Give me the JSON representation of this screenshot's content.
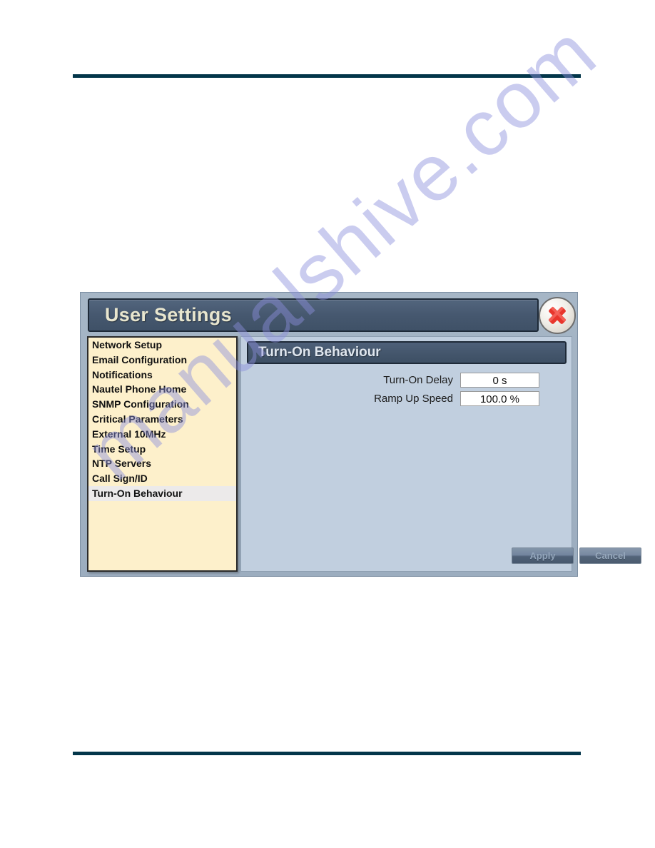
{
  "page": {
    "rule_color": "#03364a",
    "watermark": "manualshive.com"
  },
  "dialog": {
    "title": "User Settings",
    "close_icon": "close-x-icon",
    "sidebar": {
      "items": [
        {
          "label": "Network Setup",
          "selected": false
        },
        {
          "label": "Email Configuration",
          "selected": false
        },
        {
          "label": "Notifications",
          "selected": false
        },
        {
          "label": "Nautel Phone Home",
          "selected": false
        },
        {
          "label": "SNMP Configuration",
          "selected": false
        },
        {
          "label": "Critical Parameters",
          "selected": false
        },
        {
          "label": "External 10MHz",
          "selected": false
        },
        {
          "label": "Time Setup",
          "selected": false
        },
        {
          "label": "NTP Servers",
          "selected": false
        },
        {
          "label": "Call Sign/ID",
          "selected": false
        },
        {
          "label": "Turn-On Behaviour",
          "selected": true
        }
      ]
    },
    "panel": {
      "title": "Turn-On Behaviour",
      "fields": [
        {
          "label": "Turn-On Delay",
          "value": "0 s"
        },
        {
          "label": "Ramp Up Speed",
          "value": "100.0 %"
        }
      ],
      "buttons": [
        {
          "label": "Apply"
        },
        {
          "label": "Cancel"
        }
      ]
    }
  }
}
